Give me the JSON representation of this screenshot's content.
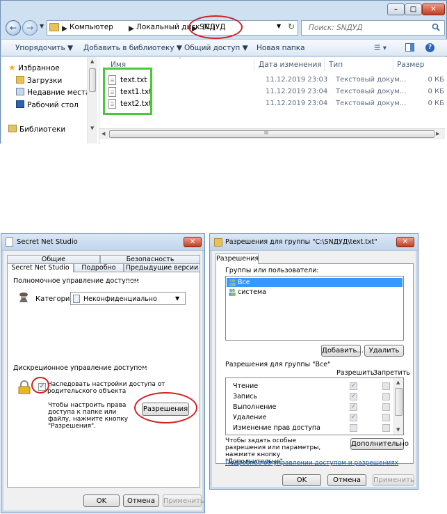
{
  "explorer": {
    "address": {
      "computer": "Компьютер",
      "drive": "Локальный диск (C:)",
      "folder": "SNДУД"
    },
    "search_placeholder": "Поиск: SNДУД",
    "toolbar": {
      "organize": "Упорядочить ▼",
      "add_to_library": "Добавить в библиотеку ▼",
      "share": "Общий доступ ▼",
      "new_folder": "Новая папка"
    },
    "nav": {
      "favorites": "Избранное",
      "downloads": "Загрузки",
      "recent": "Недавние места",
      "desktop": "Рабочий стол",
      "libraries": "Библиотеки"
    },
    "columns": {
      "name": "Имя",
      "date": "Дата изменения",
      "type": "Тип",
      "size": "Размер"
    },
    "files": [
      {
        "name": "text.txt",
        "date": "11.12.2019 23:03",
        "type": "Текстовый докум...",
        "size": "0 КБ"
      },
      {
        "name": "text1.txt",
        "date": "11.12.2019 23:04",
        "type": "Текстовый докум...",
        "size": "0 КБ"
      },
      {
        "name": "text2.txt",
        "date": "11.12.2019 23:04",
        "type": "Текстовый докум...",
        "size": "0 КБ"
      }
    ],
    "hscroll_mark": "III"
  },
  "snet_dialog": {
    "title": "Secret Net Studio",
    "tabs_row1": {
      "general": "Общие",
      "security": "Безопасность"
    },
    "tabs_row2": {
      "snet": "Secret Net Studio",
      "details": "Подробно",
      "previous": "Предыдущие версии"
    },
    "mandatory_group": "Полномочное управление доступом",
    "category_label": "Категория:",
    "category_value": "Неконфиденциально",
    "discretionary_group": "Дискреционное управление доступом",
    "inherit_text": "Наследовать настройки доступа от родительского объекта",
    "hint_text": "Чтобы настроить права доступа к папке или файлу, нажмите кнопку \"Разрешения\".",
    "permissions_button": "Разрешения",
    "ok": "OK",
    "cancel": "Отмена",
    "apply": "Применить"
  },
  "perm_dialog": {
    "title": "Разрешения для группы \"C:\\SNДУД\\text.txt\"",
    "tab": "Разрешения",
    "groups_label": "Группы или пользователи:",
    "users": [
      "Все",
      "система"
    ],
    "add_button": "Добавить...",
    "remove_button": "Удалить",
    "perms_for_label": "Разрешения для группы \"Все\"",
    "allow_header": "Разрешить",
    "deny_header": "Запретить",
    "permissions": [
      {
        "name": "Чтение",
        "allow": true,
        "deny": false
      },
      {
        "name": "Запись",
        "allow": true,
        "deny": false
      },
      {
        "name": "Выполнение",
        "allow": true,
        "deny": false
      },
      {
        "name": "Удаление",
        "allow": true,
        "deny": false
      },
      {
        "name": "Изменение прав доступа",
        "allow": false,
        "deny": false
      }
    ],
    "special_text": "Чтобы задать особые разрешения или параметры, нажмите кнопку \"Дополнительно\".",
    "advanced_button": "Дополнительно",
    "link_text": "Подробнее об управлении доступом и разрешениях",
    "ok": "OK",
    "cancel": "Отмена",
    "apply": "Применить"
  },
  "colors": {
    "highlight_red": "#d01f1f",
    "highlight_green": "#46c93a",
    "selection_blue": "#3399ff"
  }
}
